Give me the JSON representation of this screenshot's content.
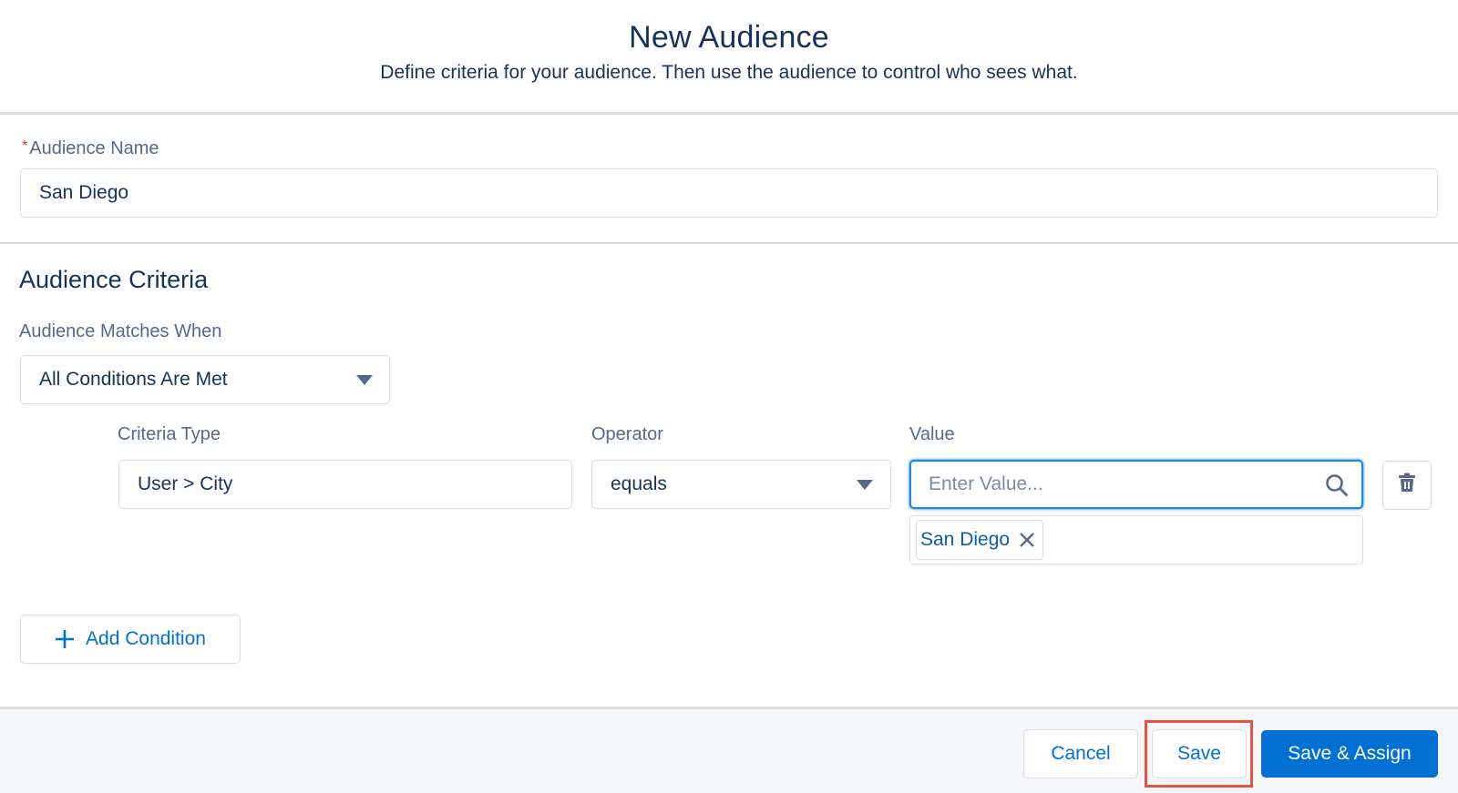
{
  "header": {
    "title": "New Audience",
    "subtitle": "Define criteria for your audience. Then use the audience to control who sees what."
  },
  "audience_name": {
    "required_marker": "*",
    "label": "Audience Name",
    "value": "San Diego"
  },
  "criteria": {
    "section_title": "Audience Criteria",
    "matches_label": "Audience Matches When",
    "matches_value": "All Conditions Are Met",
    "conditions": [
      {
        "criteria_type_label": "Criteria Type",
        "criteria_type_value": "User > City",
        "operator_label": "Operator",
        "operator_value": "equals",
        "value_label": "Value",
        "value_placeholder": "Enter Value...",
        "selected_values": [
          "San Diego"
        ]
      }
    ],
    "add_condition_label": "Add Condition"
  },
  "footer": {
    "cancel_label": "Cancel",
    "save_label": "Save",
    "save_assign_label": "Save & Assign"
  },
  "colors": {
    "brand": "#0070d2",
    "text": "#16325c",
    "label": "#54698d",
    "highlight": "#e6543f"
  },
  "icons": {
    "dropdown": "chevron-down-icon",
    "search": "search-icon",
    "delete": "trash-icon",
    "add": "plus-icon",
    "remove": "close-icon"
  }
}
